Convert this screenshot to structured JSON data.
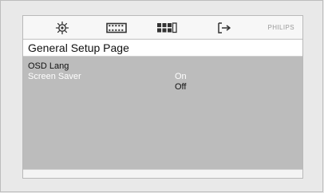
{
  "header": {
    "icons": [
      "gear-icon",
      "film-icon",
      "grid-icon",
      "exit-icon"
    ],
    "brand": "PHILIPS"
  },
  "page": {
    "title": "General Setup Page"
  },
  "menu": {
    "items": [
      {
        "label": "OSD Lang"
      },
      {
        "label": "Screen Saver"
      }
    ]
  },
  "options": [
    {
      "label": "On"
    },
    {
      "label": "Off"
    }
  ]
}
